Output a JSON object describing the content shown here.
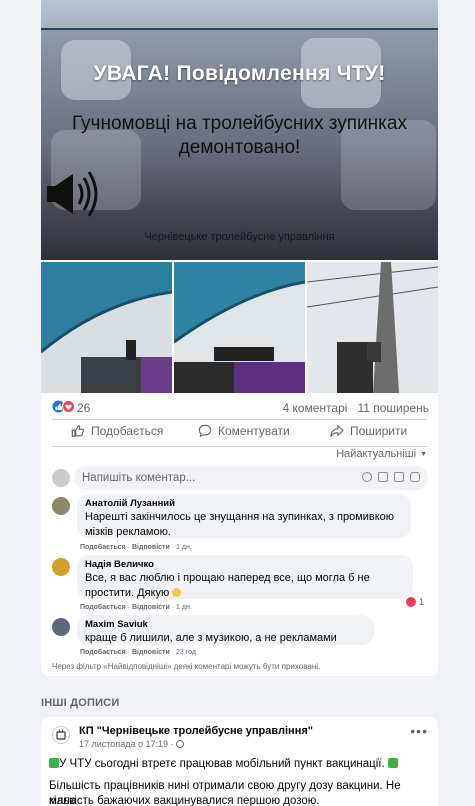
{
  "post": {
    "hero": {
      "title": "УВАГА!  Повідомлення ЧТУ!",
      "subtitle_line1": "Гучномовці на тролейбусних зупинках",
      "subtitle_line2": "демонтовано!",
      "footer": "Чернівецьке тролейбусне управління"
    },
    "reactions_count": "26",
    "comments_count": "4 коментарі",
    "shares_count": "11 поширень",
    "actions": {
      "like": "Подобається",
      "comment": "Коментувати",
      "share": "Поширити"
    },
    "sort_label": "Найактуальніші",
    "comment_placeholder": "Напишіть коментар..."
  },
  "comments": [
    {
      "author": "Анатолій Лузанний",
      "line1": "Нарешті закінчилось це знущання на зупинках, з промивкою",
      "line2": "мізків рекламою.",
      "like": "Подобається",
      "reply": "Відповісти",
      "time": "1 дн."
    },
    {
      "author": "Надія Величко",
      "line1": "Все, я вас люблю і прощаю наперед все, що могла б не",
      "line2": "простити. Дякую",
      "like": "Подобається",
      "reply": "Відповісти",
      "time": "1 дн.",
      "reaction_count": "1"
    },
    {
      "author": "Maxim Saviuk",
      "line1": "краще б лишили, але з музикою, а не рекламами",
      "like": "Подобається",
      "reply": "Відповісти",
      "time": "23 год"
    }
  ],
  "filter_note": "Через фільтр «Найвідповідніші» деякі коментарі можуть бути приховані.",
  "other_posts": {
    "section_title": "ІНШІ ДОПИСИ",
    "page_name": "КП \"Чернівецьке тролейбусне управління\"",
    "date": "17 листопада о 17:19 ·",
    "text_line1": "У ЧТУ сьогодні втретє працював мобільний пункт вакцинації.",
    "text_line2": "Більшість працівників нині отримали свою другу дозу вакцини. Не мала",
    "text_line3": "кількість бажаючих вакцинувалися першою дозою."
  },
  "colors": {
    "like_blue": "#1877f2",
    "love_red": "#f33e58",
    "text_secondary": "#65676b",
    "bg": "#f0f2f5"
  }
}
